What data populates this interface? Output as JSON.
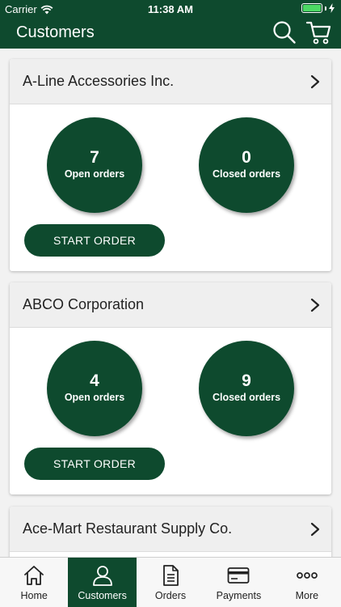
{
  "status_bar": {
    "carrier": "Carrier",
    "time": "11:38 AM",
    "battery_level": 1.0
  },
  "header": {
    "title": "Customers",
    "icons": [
      "search-icon",
      "cart-icon"
    ]
  },
  "customers": [
    {
      "name": "A-Line Accessories Inc.",
      "open_count": "7",
      "open_label": "Open orders",
      "closed_count": "0",
      "closed_label": "Closed orders",
      "button_label": "START ORDER"
    },
    {
      "name": "ABCO Corporation",
      "open_count": "4",
      "open_label": "Open orders",
      "closed_count": "9",
      "closed_label": "Closed orders",
      "button_label": "START ORDER"
    },
    {
      "name": "Ace-Mart Restaurant Supply Co."
    }
  ],
  "tabs": [
    {
      "label": "Home",
      "icon": "home-icon",
      "active": false
    },
    {
      "label": "Customers",
      "icon": "person-icon",
      "active": true
    },
    {
      "label": "Orders",
      "icon": "document-icon",
      "active": false
    },
    {
      "label": "Payments",
      "icon": "credit-card-icon",
      "active": false
    },
    {
      "label": "More",
      "icon": "more-icon",
      "active": false
    }
  ],
  "colors": {
    "brand": "#0e4a2e",
    "battery": "#4cd964"
  }
}
